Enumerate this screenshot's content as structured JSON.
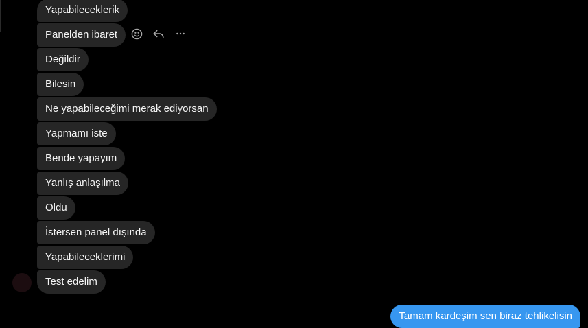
{
  "conversation": {
    "received": [
      {
        "text": "Yapabileceklerik"
      },
      {
        "text": "Panelden ibaret"
      },
      {
        "text": "Değildir"
      },
      {
        "text": "Bilesin"
      },
      {
        "text": "Ne yapabileceğimi merak ediyorsan"
      },
      {
        "text": "Yapmamı iste"
      },
      {
        "text": "Bende yapayım"
      },
      {
        "text": "Yanlış anlaşılma"
      },
      {
        "text": "Oldu"
      },
      {
        "text": "İstersen panel dışında"
      },
      {
        "text": "Yapabileceklerimi"
      },
      {
        "text": "Test edelim"
      }
    ],
    "sent": [
      {
        "text": "Tamam kardeşim sen biraz tehlikelisin"
      }
    ],
    "hover_actions": {
      "icons": [
        "emoji-react-icon",
        "reply-icon",
        "more-options-icon"
      ]
    }
  },
  "colors": {
    "background": "#000000",
    "received_bubble": "#262626",
    "sent_bubble": "#3797f0",
    "text": "#f5f5f5",
    "icon": "#a8a8a8"
  }
}
